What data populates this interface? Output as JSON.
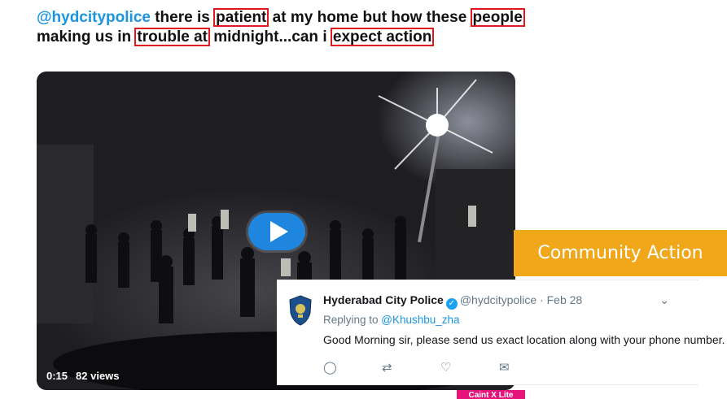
{
  "tweet": {
    "mention": "@hydcitypolice",
    "t1": " there is ",
    "w1": "patient",
    "t2": " at my home but how these ",
    "w2": "people",
    "t3": " making us in ",
    "w3": "trouble at",
    "t4": " midnight...can i ",
    "w4": "expect action"
  },
  "video": {
    "duration": "0:15",
    "views": "82 views"
  },
  "banner": {
    "label": "Community Action"
  },
  "reply": {
    "name": "Hyderabad City Police",
    "handle_date": "@hydcitypolice · Feb 28",
    "replying_prefix": "Replying to ",
    "replying_to": "@Khushbu_zha",
    "body": "Good Morning sir, please send us exact location along with your phone number."
  },
  "badge": {
    "label": "Caint X Lite"
  },
  "colors": {
    "accent": "#1b95e0",
    "highlight_box": "#e0191f",
    "banner": "#f0a81a",
    "badge": "#e6147a"
  },
  "icons": [
    "play-icon",
    "verified-icon",
    "chevron-down-icon",
    "reply-icon",
    "retweet-icon",
    "like-icon",
    "message-icon"
  ]
}
